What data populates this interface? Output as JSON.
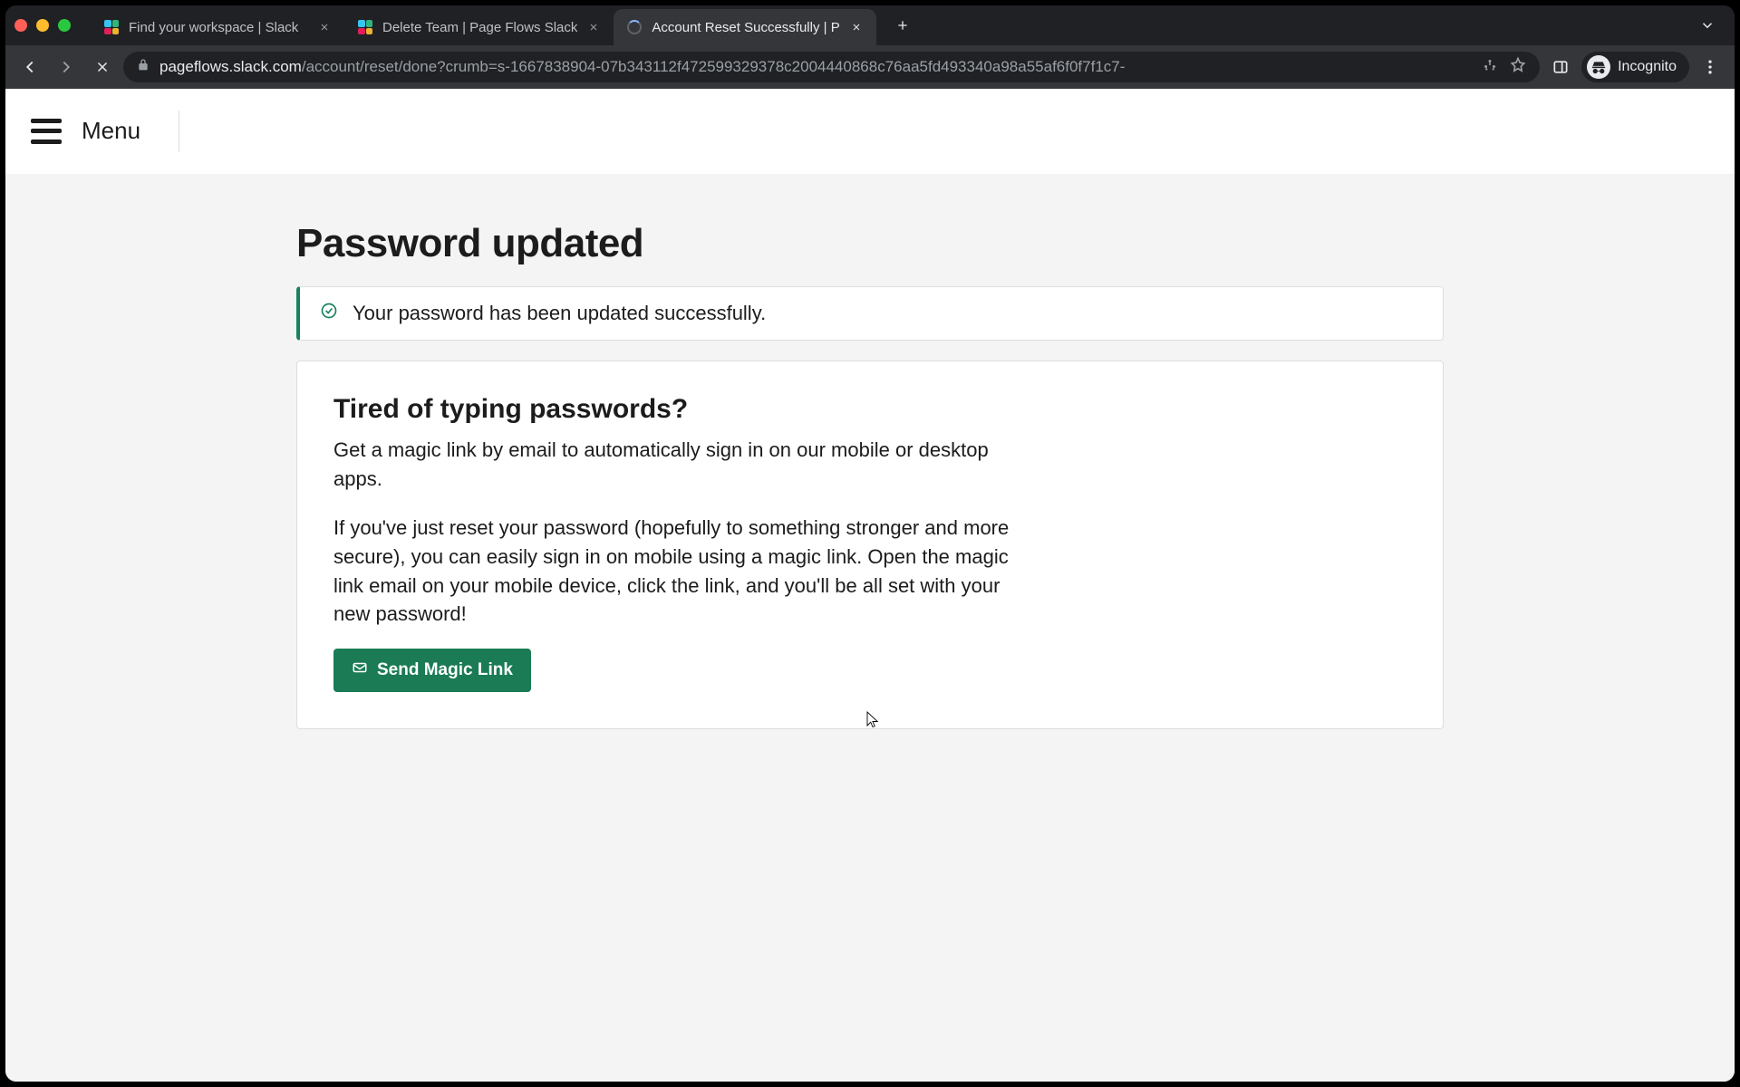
{
  "browser": {
    "tabs": [
      {
        "title": "Find your workspace | Slack",
        "favicon": "slack",
        "active": false
      },
      {
        "title": "Delete Team | Page Flows Slack",
        "favicon": "slack",
        "active": false
      },
      {
        "title": "Account Reset Successfully | P",
        "favicon": "loading",
        "active": true
      }
    ],
    "url_host": "pageflows.slack.com",
    "url_path": "/account/reset/done?crumb=s-1667838904-07b343112f472599329378c2004440868c76aa5fd493340a98a55af6f0f7f1c7-",
    "incognito_label": "Incognito"
  },
  "site": {
    "menu_label": "Menu"
  },
  "page": {
    "title": "Password updated",
    "alert_text": "Your password has been updated successfully.",
    "card_title": "Tired of typing passwords?",
    "card_p1": "Get a magic link by email to automatically sign in on our mobile or desktop apps.",
    "card_p2": "If you've just reset your password (hopefully to something stronger and more secure), you can easily sign in on mobile using a magic link. Open the magic link email on your mobile device, click the link, and you'll be all set with your new password!",
    "button_label": "Send Magic Link"
  }
}
